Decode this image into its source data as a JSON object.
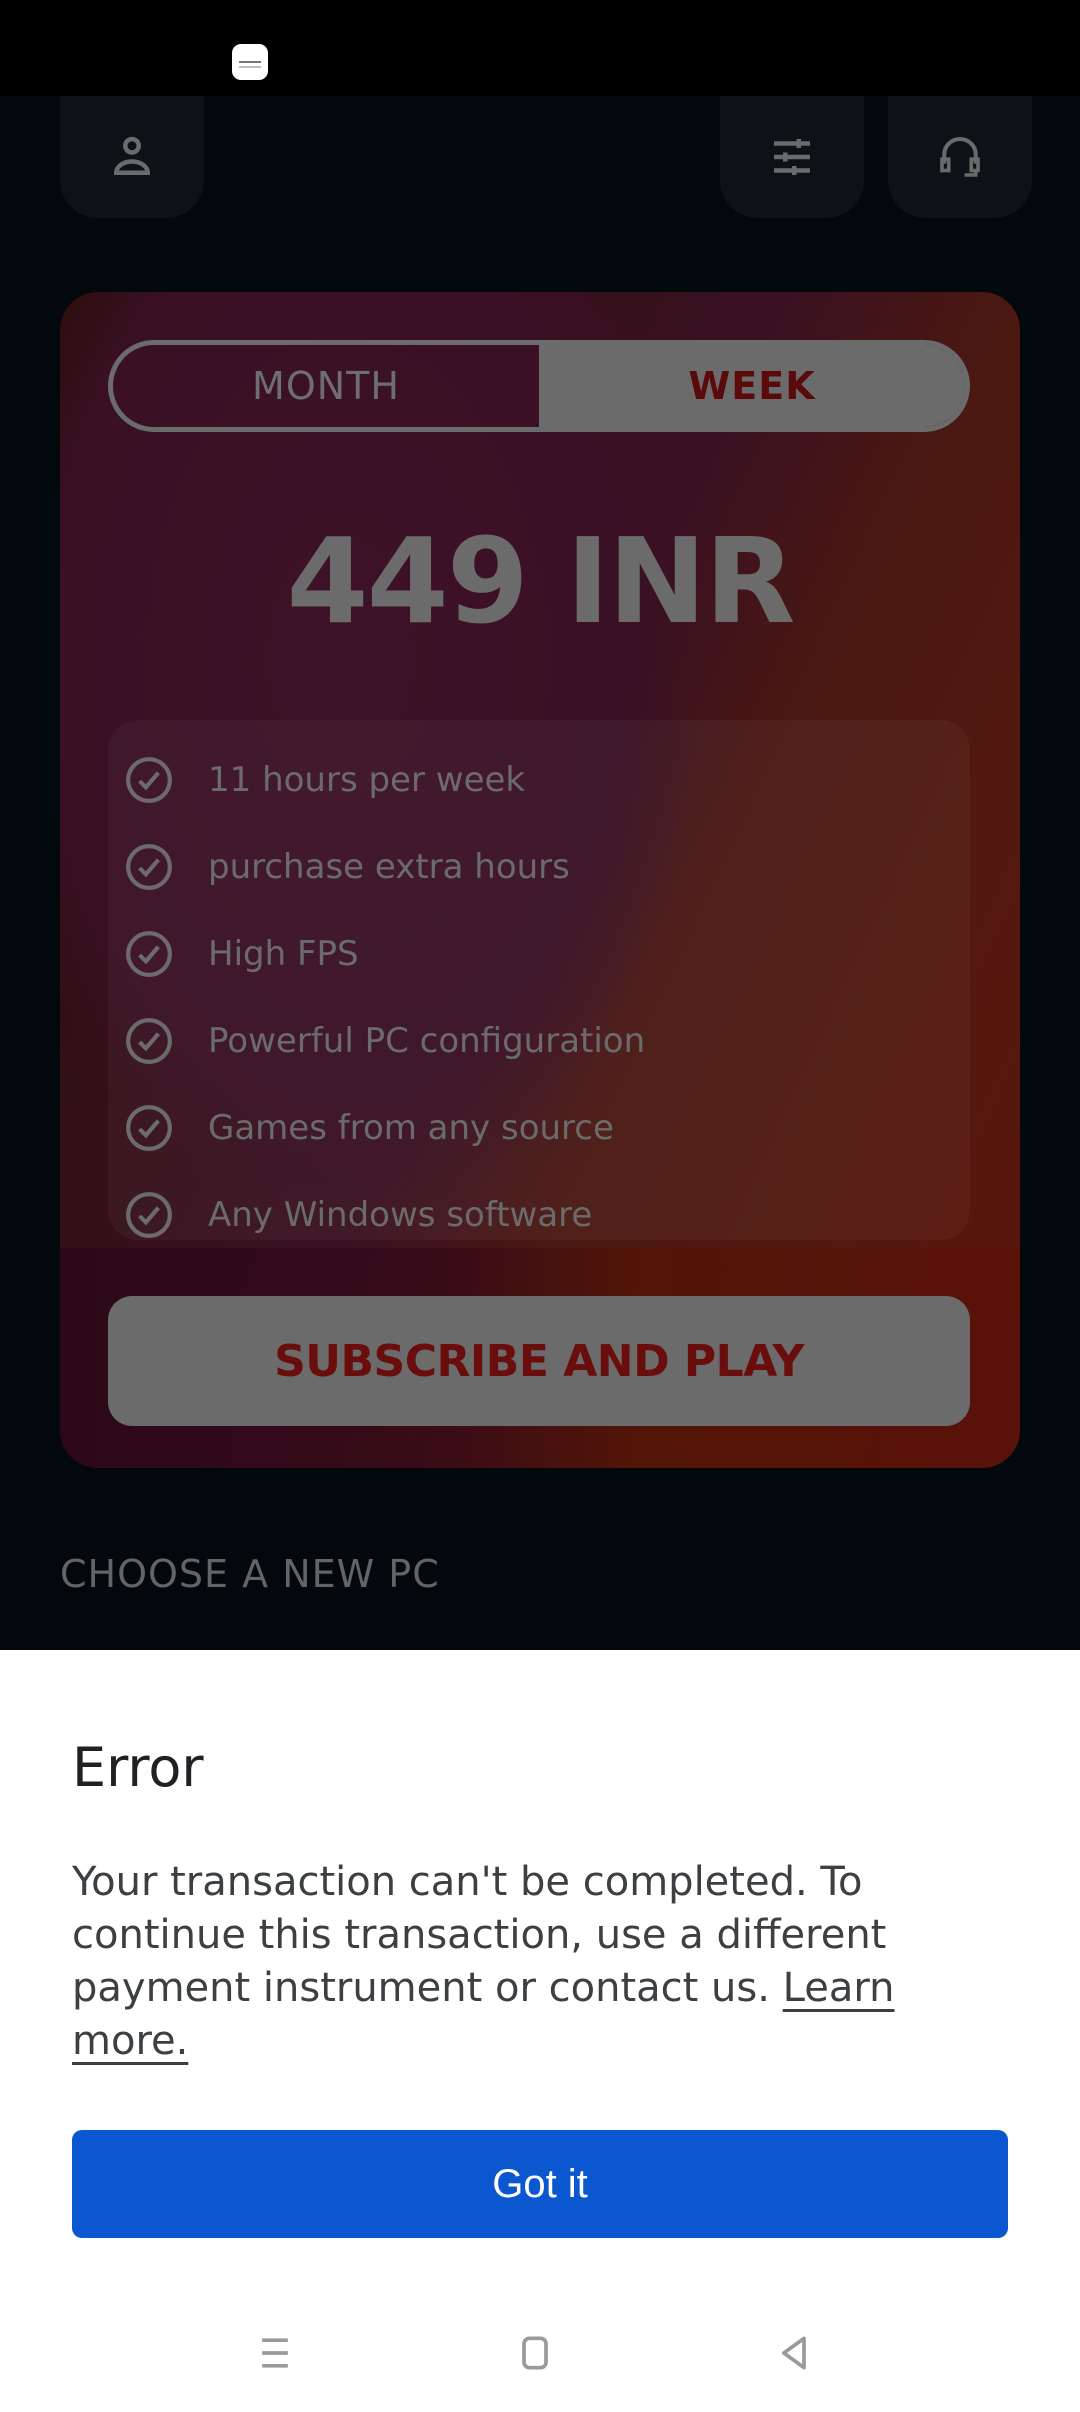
{
  "status_bar": {
    "notification_icon": "app-notification-icon"
  },
  "header": {
    "buttons": [
      {
        "name": "profile",
        "icon": "person-icon"
      },
      {
        "name": "settings",
        "icon": "sliders-icon"
      },
      {
        "name": "support",
        "icon": "headset-icon"
      }
    ]
  },
  "plan_card": {
    "toggle": {
      "options": [
        "MONTH",
        "WEEK"
      ],
      "selected": "WEEK"
    },
    "price": "449 INR",
    "features": [
      "11 hours per week",
      "purchase extra hours",
      "High FPS",
      "Powerful PC configuration",
      "Games from any source",
      "Any Windows software"
    ],
    "cta_label": "SUBSCRIBE AND PLAY"
  },
  "section_title": "CHOOSE A NEW PC",
  "error_sheet": {
    "title": "Error",
    "message": "Your transaction can't be completed. To continue this transaction, use a different payment instrument or contact us.",
    "link_label": "Learn more.",
    "button_label": "Got it",
    "button_color": "#0b57cf"
  },
  "nav_bar": {
    "buttons": [
      "recents",
      "home",
      "back"
    ]
  }
}
